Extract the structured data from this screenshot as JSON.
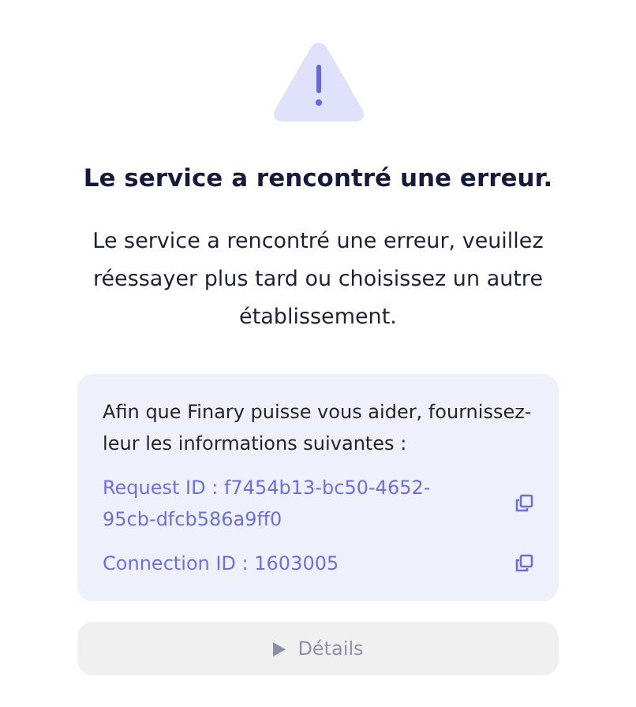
{
  "title": "Le service a rencontré une erreur.",
  "message": "Le service a rencontré une erreur, veuillez réessayer plus tard ou choisissez un autre établissement.",
  "info": {
    "intro": "Afin que Finary puisse vous aider, fournissez-leur les informations suivantes :",
    "ids": [
      {
        "text": "Request ID : f7454b13-bc50-4652-95cb-dfcb586a9ff0"
      },
      {
        "text": "Connection ID : 1603005"
      }
    ]
  },
  "details": {
    "label": "Détails",
    "expanded": false
  }
}
